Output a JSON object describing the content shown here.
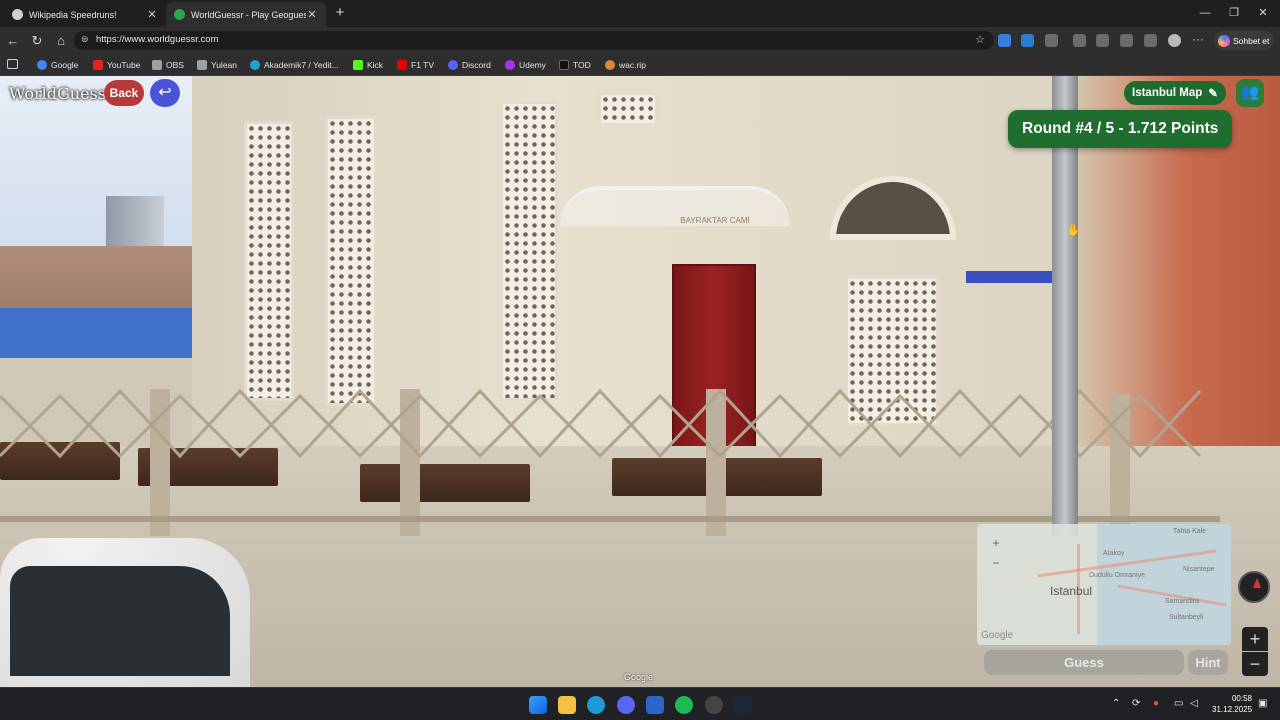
{
  "browser": {
    "tabs": [
      {
        "title": "Wikipedia Speedruns!",
        "active": false
      },
      {
        "title": "WorldGuessr - Play Geoguessr for",
        "active": true
      }
    ],
    "url": "https://www.worldguessr.com",
    "chat_button": "Sohbet et",
    "bookmarks": [
      {
        "label": "Google",
        "color": "#4285f4"
      },
      {
        "label": "YouTube",
        "color": "#e62117"
      },
      {
        "label": "OBS",
        "color": "#9aa0a6"
      },
      {
        "label": "Yulean",
        "color": "#9aa0a6"
      },
      {
        "label": "Akademik7 / Yedit...",
        "color": "#21a1d8"
      },
      {
        "label": "Kick",
        "color": "#53fc18"
      },
      {
        "label": "F1 TV",
        "color": "#e10600"
      },
      {
        "label": "Discord",
        "color": "#5865f2"
      },
      {
        "label": "Udemy",
        "color": "#a435f0"
      },
      {
        "label": "TOD",
        "color": "#111111"
      },
      {
        "label": "wac.rip",
        "color": "#e0853a"
      }
    ]
  },
  "game": {
    "logo": "WorldGuessr",
    "back_label": "Back",
    "map_name": "Istanbul Map",
    "round_text": "Round #4 / 5 - 1.712 Points",
    "minimap_city": "Istanbul",
    "minimap_labels": [
      "Atakoy",
      "Tahta Kale",
      "Dudullu Omraniye",
      "Nisantepe",
      "Samandira",
      "Sultanbeyli"
    ],
    "guess_label": "Guess",
    "hint_label": "Hint",
    "google_attribution": "Google",
    "minimap_google": "Google",
    "sign_text": "BAYRAKTAR CAMİ"
  },
  "taskbar": {
    "time": "00:58",
    "date": "31.12.2025"
  }
}
